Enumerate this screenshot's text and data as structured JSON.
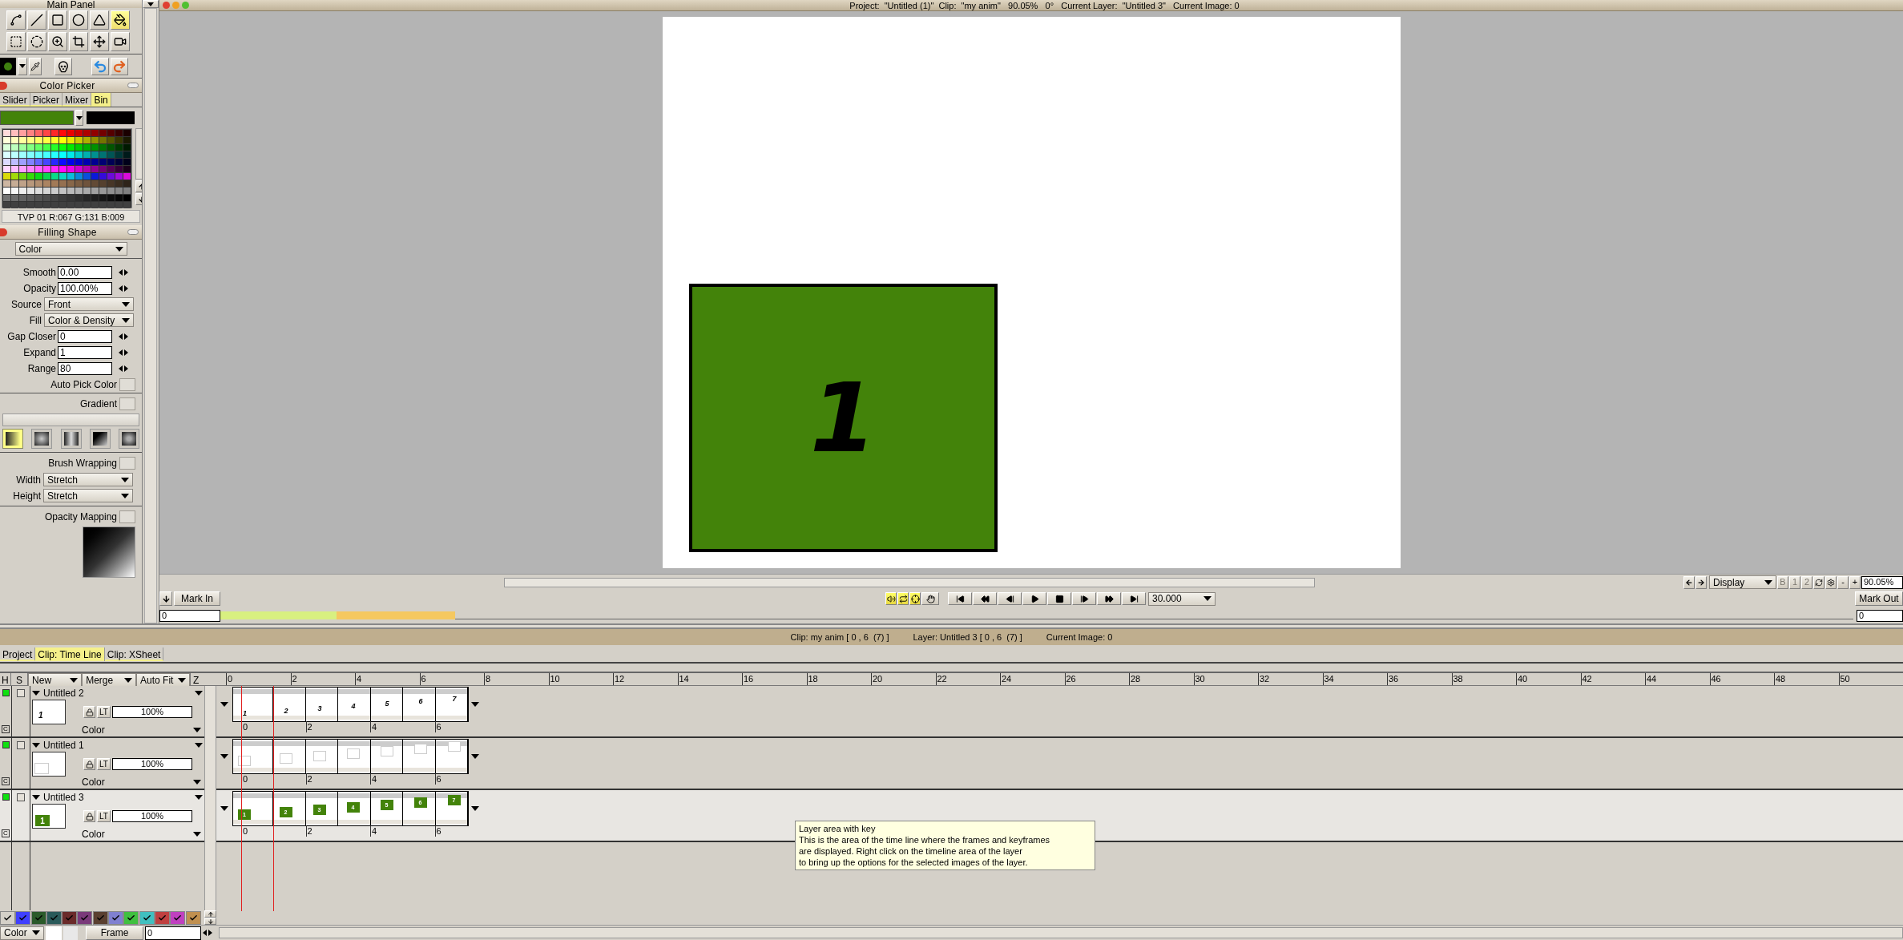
{
  "title_bar": {
    "text": "Project:  \"Untitled (1)\"  Clip:  \"my anim\"   90.05%   0°   Current Layer:  \"Untitled 3\"   Current Image: 0"
  },
  "main_panel": {
    "title": "Main Panel"
  },
  "color_picker": {
    "title": "Color Picker",
    "tabs": [
      {
        "label": "Slider",
        "selected": false
      },
      {
        "label": "Picker",
        "selected": false
      },
      {
        "label": "Mixer",
        "selected": false
      },
      {
        "label": "Bin",
        "selected": true
      }
    ],
    "info": "TVP 01 R:067 G:131 B:009"
  },
  "filling_shape": {
    "title": "Filling Shape",
    "mode": "Color",
    "fields": [
      {
        "kind": "number",
        "label": "Smooth",
        "value": "0.00"
      },
      {
        "kind": "number",
        "label": "Opacity",
        "value": "100.00%"
      },
      {
        "kind": "select",
        "label": "Source",
        "value": "Front"
      },
      {
        "kind": "select",
        "label": "Fill",
        "value": "Color & Density"
      },
      {
        "kind": "number",
        "label": "Gap Closer",
        "value": "0"
      },
      {
        "kind": "number",
        "label": "Expand",
        "value": "1"
      },
      {
        "kind": "number",
        "label": "Range",
        "value": "80"
      },
      {
        "kind": "check",
        "label": "Auto Pick Color",
        "checked": false
      }
    ],
    "gradient": {
      "label": "Gradient",
      "checked": false,
      "types": [
        {
          "selected": true
        },
        {
          "selected": false
        },
        {
          "selected": false
        },
        {
          "selected": false
        },
        {
          "selected": false
        }
      ]
    },
    "brush_wrapping": {
      "label": "Brush Wrapping",
      "checked": false,
      "fields": [
        {
          "label": "Width",
          "value": "Stretch"
        },
        {
          "label": "Height",
          "value": "Stretch"
        }
      ]
    },
    "opacity_mapping": {
      "label": "Opacity Mapping",
      "checked": false
    }
  },
  "canvas": {
    "image_label": "1"
  },
  "transport": {
    "mark_in": "Mark In",
    "mark_in_value": "0",
    "fps": "30.000",
    "display": "Display",
    "view_buttons": [
      {
        "label": "B",
        "disabled": true
      },
      {
        "label": "1",
        "disabled": true
      },
      {
        "label": "2",
        "disabled": true
      }
    ],
    "zoom_out": "-",
    "zoom_in": "+",
    "zoom": "90.05%",
    "mark_out": "Mark Out",
    "mark_out_value": "0"
  },
  "status_line": {
    "clip": "Clip: my anim [ 0 , 6  (7) ]",
    "layer": "Layer: Untitled 3 [ 0 , 6  (7) ]",
    "image": "Current Image: 0"
  },
  "tabs": [
    {
      "label": "Project",
      "selected": false
    },
    {
      "label": "Clip: Time Line",
      "selected": true
    },
    {
      "label": "Clip: XSheet",
      "selected": false
    }
  ],
  "layer_header": {
    "h": "H",
    "s": "S",
    "new": "New",
    "merge": "Merge",
    "auto_fit": "Auto Fit",
    "z": "Z"
  },
  "ruler": [
    "0",
    "2",
    "4",
    "6",
    "8",
    "10",
    "12",
    "14",
    "16",
    "18",
    "20",
    "22",
    "24",
    "26",
    "28",
    "30",
    "32",
    "34",
    "36",
    "38",
    "40",
    "42",
    "44",
    "46",
    "48",
    "50"
  ],
  "layers": [
    {
      "name": "Untitled 2",
      "visible": true,
      "selected": false,
      "c_label": "C",
      "lt_label": "LT",
      "opacity": "100%",
      "mode": "Color",
      "thumb_label": "1",
      "ticks": [
        "0",
        "2",
        "4",
        "6"
      ],
      "frames": [
        {
          "kind": "number",
          "label": "1"
        },
        {
          "kind": "number",
          "label": "2"
        },
        {
          "kind": "number",
          "label": "3"
        },
        {
          "kind": "number",
          "label": "4"
        },
        {
          "kind": "number",
          "label": "5"
        },
        {
          "kind": "number",
          "label": "6"
        },
        {
          "kind": "number",
          "label": "7"
        }
      ]
    },
    {
      "name": "Untitled 1",
      "visible": true,
      "selected": false,
      "c_label": "C",
      "lt_label": "LT",
      "opacity": "100%",
      "mode": "Color",
      "ticks": [
        "0",
        "2",
        "4",
        "6"
      ],
      "frames": [
        {
          "kind": "box"
        },
        {
          "kind": "box"
        },
        {
          "kind": "box"
        },
        {
          "kind": "box"
        },
        {
          "kind": "box"
        },
        {
          "kind": "box"
        },
        {
          "kind": "box"
        }
      ]
    },
    {
      "name": "Untitled 3",
      "visible": true,
      "selected": true,
      "c_label": "C",
      "lt_label": "LT",
      "opacity": "100%",
      "mode": "Color",
      "thumb_label": "1",
      "ticks": [
        "0",
        "2",
        "4",
        "6"
      ],
      "frames": [
        {
          "kind": "tile",
          "label": "1"
        },
        {
          "kind": "tile",
          "label": "2"
        },
        {
          "kind": "tile",
          "label": "3"
        },
        {
          "kind": "tile",
          "label": "4"
        },
        {
          "kind": "tile",
          "label": "5"
        },
        {
          "kind": "tile",
          "label": "6"
        },
        {
          "kind": "tile",
          "label": "7"
        }
      ]
    }
  ],
  "color_tags": [
    {
      "color": "#d4d0c8"
    },
    {
      "color": "#4040ff"
    },
    {
      "color": "#2a5a2a"
    },
    {
      "color": "#2a5a5a"
    },
    {
      "color": "#6a2a2a"
    },
    {
      "color": "#7a3a7a"
    },
    {
      "color": "#5a4030"
    },
    {
      "color": "#8080d0"
    },
    {
      "color": "#40c040"
    },
    {
      "color": "#40c0c0"
    },
    {
      "color": "#c04040"
    },
    {
      "color": "#c040c0"
    },
    {
      "color": "#c09050"
    }
  ],
  "footer": {
    "color_mode": "Color",
    "frame_label": "Frame",
    "frame_value": "0"
  },
  "tooltip": {
    "title": "Layer area with key",
    "lines": [
      "This is the area of the time line where the frames and keyframes",
      "are displayed. Right click on the timeline area of the layer",
      "to bring up the options for the selected images of the layer."
    ]
  }
}
